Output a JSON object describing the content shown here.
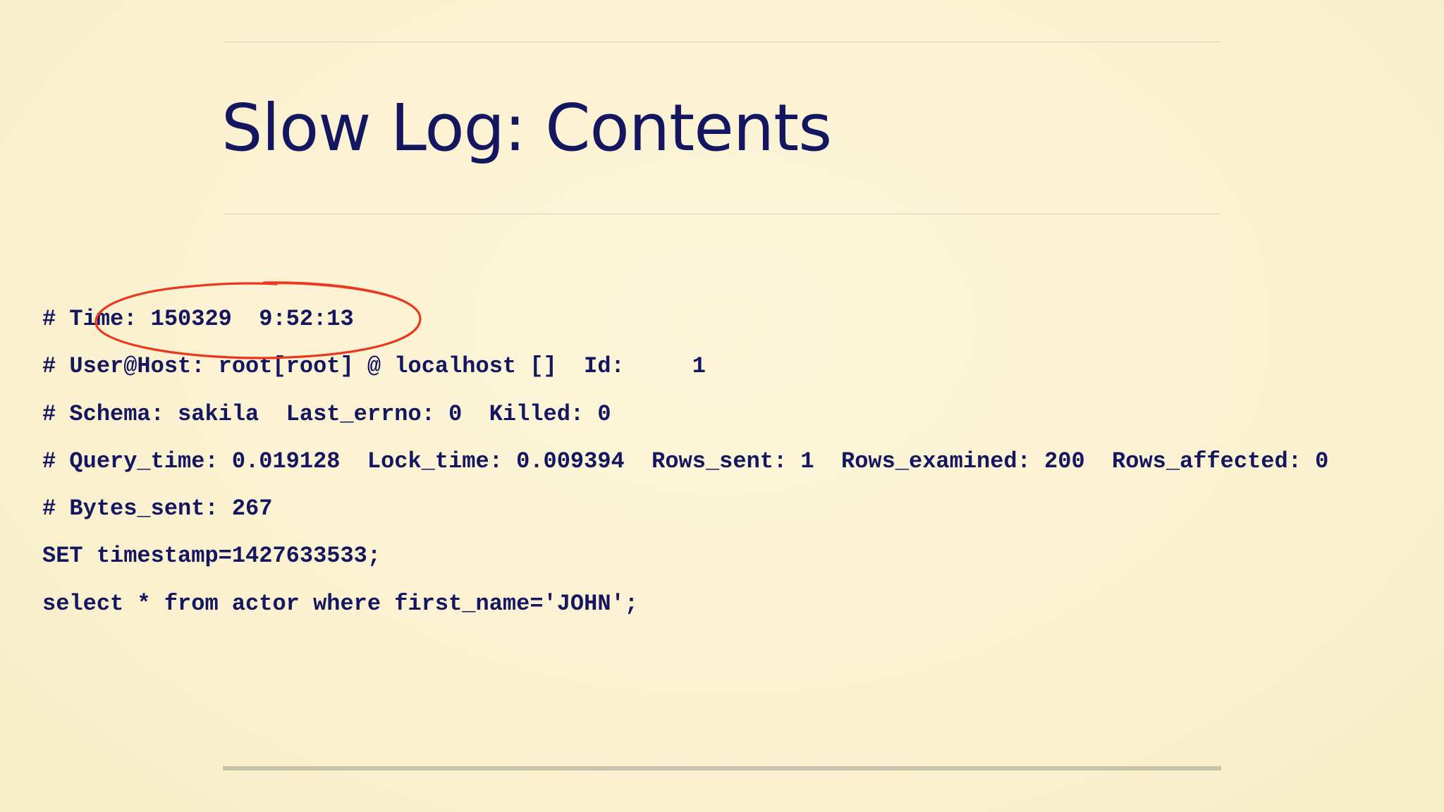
{
  "slide": {
    "title": "Slow Log: Contents",
    "log_lines": [
      "# Time: 150329  9:52:13",
      "# User@Host: root[root] @ localhost []  Id:     1",
      "# Schema: sakila  Last_errno: 0  Killed: 0",
      "# Query_time: 0.019128  Lock_time: 0.009394  Rows_sent: 1  Rows_examined: 200  Rows_affected: 0",
      "# Bytes_sent: 267",
      "SET timestamp=1427633533;",
      "select * from actor where first_name='JOHN';"
    ]
  },
  "colors": {
    "background": "#fbf3d3",
    "text": "#14175f",
    "annotation": "#e8391f",
    "rule": "#dcd6bd"
  }
}
